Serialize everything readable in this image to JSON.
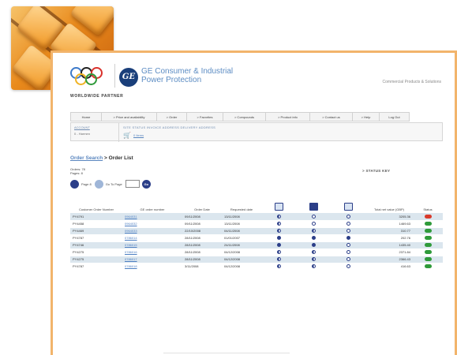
{
  "brand": {
    "company": "GE Consumer & Industrial Power Protection",
    "company_line1": "GE Consumer & Industrial",
    "company_line2": "Power Protection",
    "worldwide": "WORLDWIDE PARTNER",
    "tagline": "Commercial Products & Solutions",
    "ge_mark": "GE"
  },
  "nav": {
    "items": [
      "Home",
      "> Price and availability",
      "> Order",
      "> Favorites",
      "> Compounds",
      "> Product info",
      "> Contact us",
      "> Help",
      "Log Out"
    ]
  },
  "subbar": {
    "account_label": "ACCOUNT",
    "account_value": "0 - Harmen",
    "status_links": "SITE STATUS  INVOICE ADDRESS  DELIVERY ADDRESS",
    "cart_items": "0 Items"
  },
  "page": {
    "breadcrumb": "Order Search",
    "breadcrumb_sep": ">",
    "title": "Order List",
    "orders_line1": "Orders: 78",
    "orders_line2": "Pages: 8",
    "status_key": "> STATUS KEY",
    "page_label": "Page 8",
    "goto_label": "Go To Page",
    "go": "Go"
  },
  "table": {
    "headers": [
      "Customer Order Number",
      "GE order number",
      "Order Date",
      "Requested date",
      "",
      "",
      "",
      "Total net value (GBP)",
      "Status"
    ],
    "header_icons": [
      "order-icon",
      "truck-icon",
      "invoice-icon"
    ],
    "rows": [
      {
        "cust": "PY4791",
        "ge": "0964031",
        "date": "09/11/2008",
        "req": "13/11/2008",
        "s1": "half",
        "s2": "empty",
        "s3": "empty",
        "value": "3205.36",
        "status": "red"
      },
      {
        "cust": "PY4458",
        "ge": "0964032",
        "date": "09/11/2008",
        "req": "13/11/2008",
        "s1": "half",
        "s2": "empty",
        "s3": "empty",
        "value": "1469.63",
        "status": "green"
      },
      {
        "cust": "PY4469",
        "ge": "0964033",
        "date": "22/10/2008",
        "req": "04/11/2008",
        "s1": "half",
        "s2": "half",
        "s3": "empty",
        "value": "310.77",
        "status": "green"
      },
      {
        "cust": "PY4787",
        "ge": "0786014",
        "date": "28/11/2008",
        "req": "01/01/2007",
        "s1": "full",
        "s2": "full",
        "s3": "full",
        "value": "202.76",
        "status": "green"
      },
      {
        "cust": "PY4746",
        "ge": "0786015",
        "date": "28/11/2008",
        "req": "24/11/2008",
        "s1": "full",
        "s2": "full",
        "s3": "empty",
        "value": "1435.40",
        "status": "green"
      },
      {
        "cust": "PY4275",
        "ge": "0786016",
        "date": "28/11/2008",
        "req": "04/12/2008",
        "s1": "half",
        "s2": "half",
        "s3": "empty",
        "value": "2371.84",
        "status": "green"
      },
      {
        "cust": "PY4275",
        "ge": "0786017",
        "date": "28/11/2008",
        "req": "04/12/2008",
        "s1": "half",
        "s2": "half",
        "s3": "empty",
        "value": "2366.43",
        "status": "green"
      },
      {
        "cust": "PY4787",
        "ge": "0786018",
        "date": "3/11/2008",
        "req": "04/12/2008",
        "s1": "half",
        "s2": "half",
        "s3": "empty",
        "value": "416.63",
        "status": "green"
      }
    ]
  },
  "colors": {
    "accent": "#2b3e88",
    "link": "#4d7fc2",
    "frame": "#f2b46b",
    "row_alt": "#dbe6ee",
    "status_red": "#d83a2b",
    "status_green": "#2f9a3a"
  }
}
